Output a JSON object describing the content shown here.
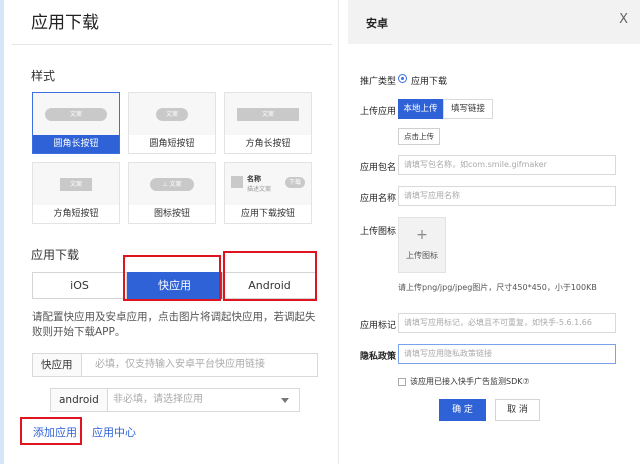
{
  "left": {
    "title": "应用下载",
    "style_section": "样式",
    "style_cards": [
      {
        "caption": "圆角长按钮",
        "pill": "文案"
      },
      {
        "caption": "圆角短按钮",
        "pill": "文案"
      },
      {
        "caption": "方角长按钮",
        "pill": "文案"
      },
      {
        "caption": "方角短按钮",
        "pill": "文案"
      },
      {
        "caption": "图标按钮",
        "pill": "⊥ 文案"
      },
      {
        "caption": "应用下载按钮",
        "app_name": "名称",
        "app_desc": "描述文案",
        "download": "下载"
      }
    ],
    "download_section": "应用下载",
    "platforms": [
      "iOS",
      "快应用",
      "Android"
    ],
    "description": "请配置快应用及安卓应用，点击图片将调起快应用，若调起失败则开始下载APP。",
    "quickapp_input": {
      "prefix": "快应用",
      "placeholder": "必填，仅支持输入安卓平台快应用链接"
    },
    "android_select": {
      "prefix": "android",
      "placeholder": "非必填，请选择应用"
    },
    "add_app": "添加应用",
    "app_center": "应用中心"
  },
  "modal": {
    "title": "安卓",
    "close": "X",
    "promo_type_label": "推广类型",
    "promo_type_value": "应用下载",
    "upload_app_label": "上传应用",
    "tabs": [
      "本地上传",
      "填写链接"
    ],
    "click_upload": "点击上传",
    "package_label": "应用包名",
    "package_placeholder": "请填写包名称，如com.smile.gifmaker",
    "appname_label": "应用名称",
    "appname_placeholder": "请填写应用名称",
    "icon_label": "上传图标",
    "upload_icon_plus": "+",
    "upload_icon_text": "上传图标",
    "icon_hint": "请上传png/jpg/jpeg图片，尺寸450*450，小于100KB",
    "tag_label": "应用标记",
    "tag_placeholder": "请填写应用标记，必填且不可重复，如快手-5.6.1.66",
    "privacy_label": "隐私政策",
    "privacy_placeholder": "请填写应用隐私政策链接",
    "sdk_checkbox": "该应用已接入快手广告监测SDK⑦",
    "confirm": "确 定",
    "cancel": "取 消"
  },
  "colors": {
    "primary": "#2f62d6",
    "highlight": "#e0141e"
  }
}
